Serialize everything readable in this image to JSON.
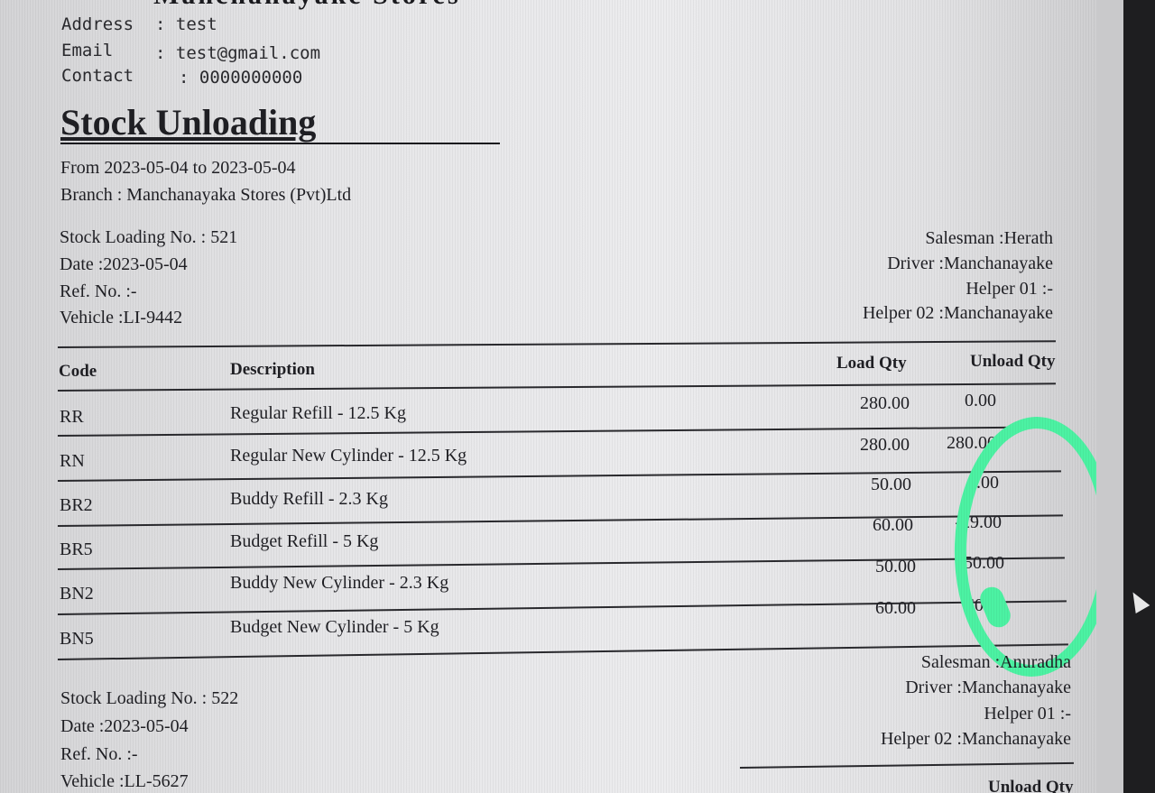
{
  "store_name": "Manchanayake Stores",
  "company": {
    "address_label": "Address",
    "address_value": ": test",
    "email_label": "Email",
    "email_value": ": test@gmail.com",
    "contact_label": "Contact",
    "contact_value": ": 0000000000"
  },
  "report": {
    "title": "Stock Unloading",
    "date_range": "From 2023-05-04 to 2023-05-04",
    "branch": "Branch : Manchanayaka Stores (Pvt)Ltd"
  },
  "loading_1": {
    "number": "Stock Loading No. : 521",
    "date": "Date :2023-05-04",
    "ref": "Ref. No. :-",
    "vehicle": "Vehicle :LI-9442",
    "salesman": "Salesman :Herath",
    "driver": "Driver :Manchanayake",
    "helper1": "Helper 01 :-",
    "helper2": "Helper 02 :Manchanayake"
  },
  "table": {
    "headers": {
      "code": "Code",
      "description": "Description",
      "load_qty": "Load Qty",
      "unload_qty": "Unload Qty"
    },
    "rows": [
      {
        "code": "RR",
        "description": "Regular Refill - 12.5 Kg",
        "load": "280.00",
        "unload": "0.00"
      },
      {
        "code": "RN",
        "description": "Regular New Cylinder - 12.5 Kg",
        "load": "280.00",
        "unload": "280.00"
      },
      {
        "code": "BR2",
        "description": "Buddy Refill - 2.3 Kg",
        "load": "50.00",
        "unload": "0.00"
      },
      {
        "code": "BR5",
        "description": "Budget Refill - 5 Kg",
        "load": "60.00",
        "unload": "-29.00"
      },
      {
        "code": "BN2",
        "description": "Buddy New Cylinder - 2.3 Kg",
        "load": "50.00",
        "unload": "50.00"
      },
      {
        "code": "BN5",
        "description": "Budget New Cylinder - 5 Kg",
        "load": "60.00",
        "unload": "60.00"
      }
    ]
  },
  "loading_2": {
    "number": "Stock Loading No. : 522",
    "date": "Date :2023-05-04",
    "ref": "Ref. No. :-",
    "vehicle": "Vehicle :LL-5627",
    "salesman": "Salesman :Anuradha",
    "driver": "Driver :Manchanayake",
    "helper1": "Helper 01 :-",
    "helper2": "Helper 02 :Manchanayake",
    "unload_header": "Unload Qty"
  },
  "colors": {
    "highlight_circle": "#4cf2a3",
    "paper": "#e6e6e8",
    "ink": "#1f1f24"
  }
}
